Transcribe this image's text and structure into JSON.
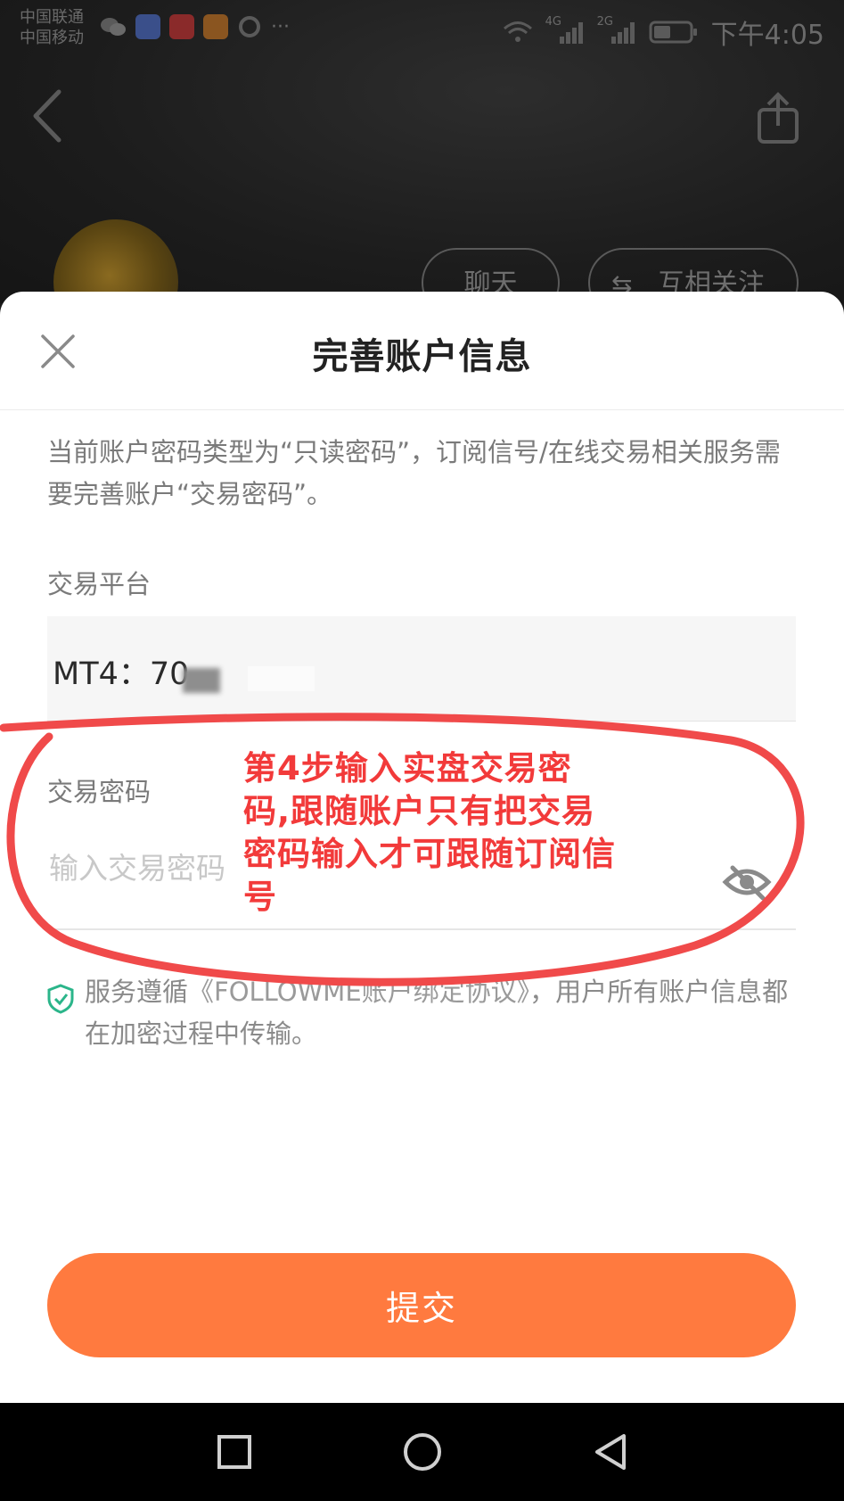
{
  "statusbar": {
    "carrier_1": "中国联通",
    "carrier_2": "中国移动",
    "more": "···",
    "network_1": "4G",
    "network_2": "2G",
    "time": "下午4:05"
  },
  "profile": {
    "chat_button": "聊天",
    "follow_button": "互相关注"
  },
  "sheet": {
    "title": "完善账户信息",
    "notice": "当前账户密码类型为“只读密码”，订阅信号/在线交易相关服务需要完善账户“交易密码”。",
    "platform_label": "交易平台",
    "platform_value": "MT4：70",
    "password_label": "交易密码",
    "password_placeholder": "输入交易密码",
    "agreement_prefix": "服务遵循",
    "agreement_link": "《FOLLOWME账户绑定协议》",
    "agreement_suffix": "，用户所有账户信息都在加密过程中传输。",
    "submit": "提交"
  },
  "annotation": {
    "text": "第4步输入实盘交易密码,跟随账户只有把交易密码输入才可跟随订阅信号",
    "color": "#f23a3a"
  },
  "colors": {
    "accent": "#ff7a3f",
    "shield": "#2bb58a"
  }
}
